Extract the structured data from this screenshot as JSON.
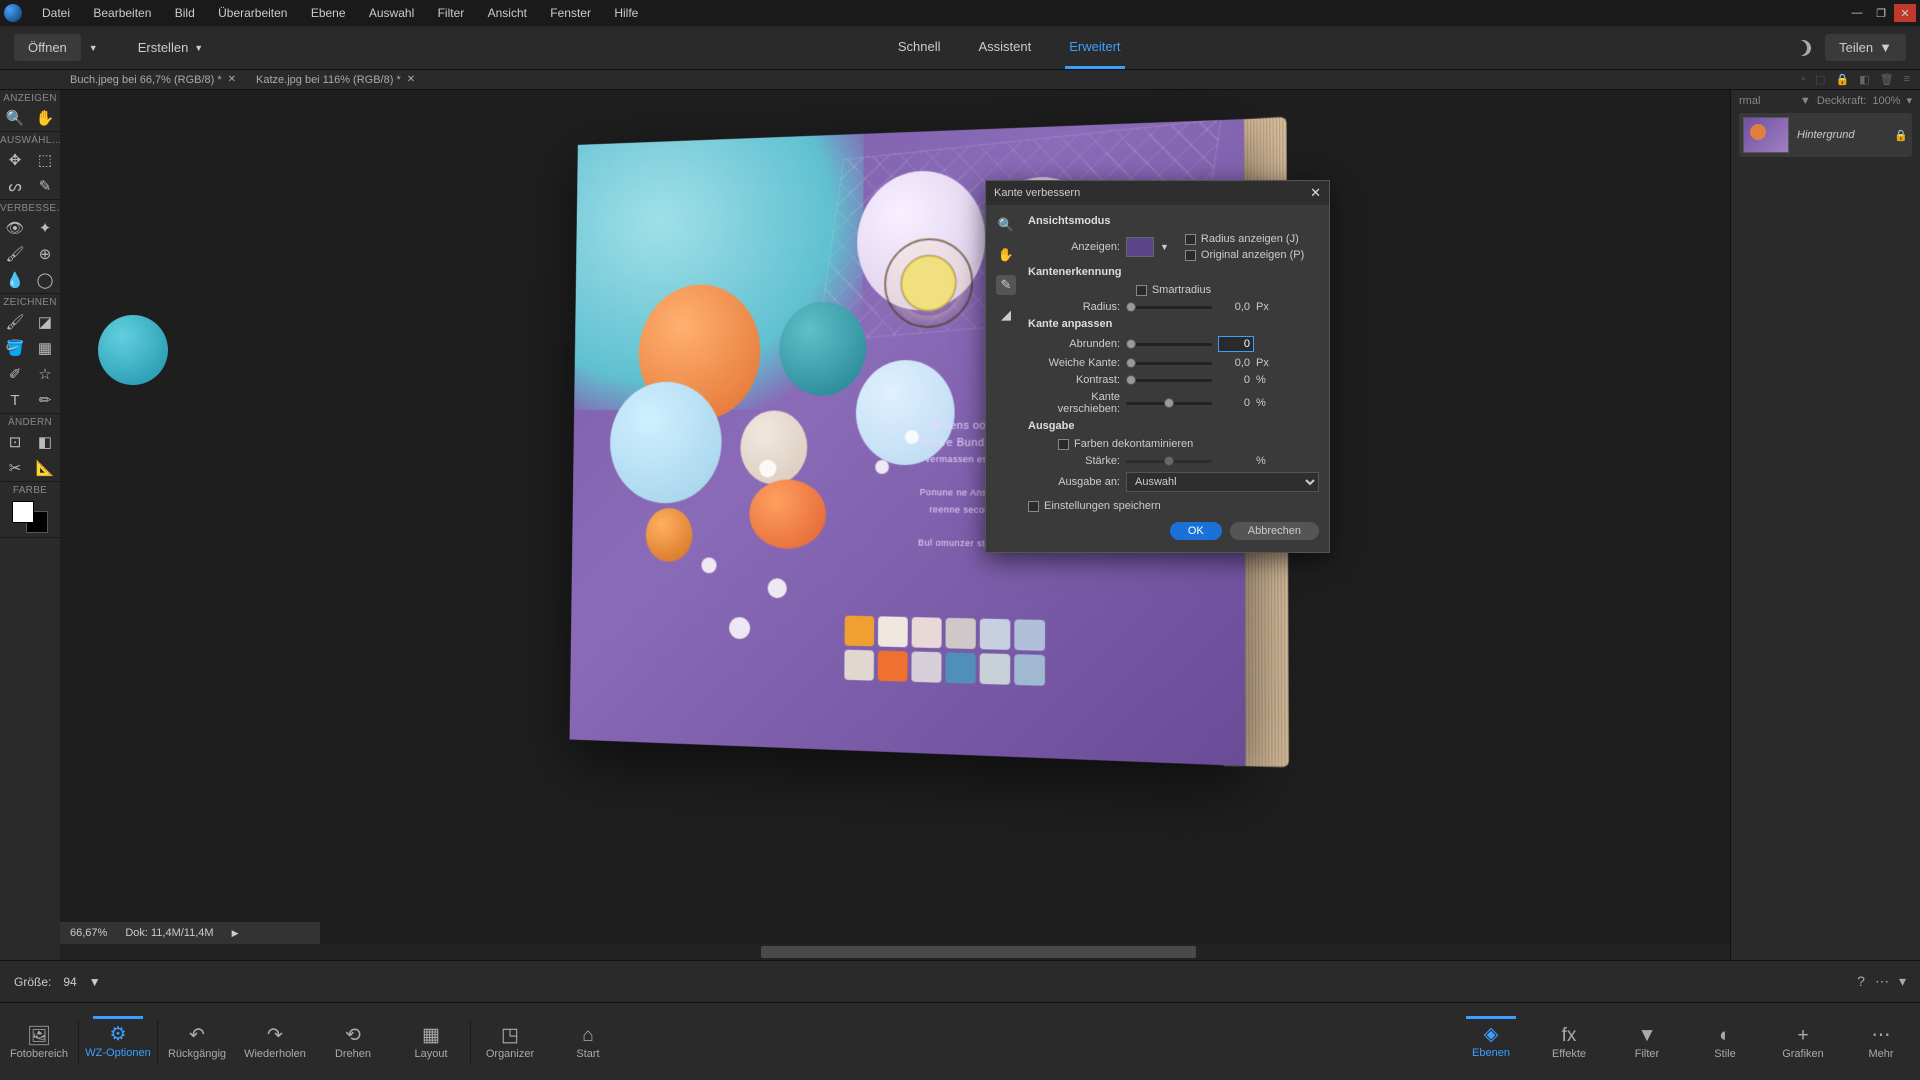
{
  "menu": [
    "Datei",
    "Bearbeiten",
    "Bild",
    "Überarbeiten",
    "Ebene",
    "Auswahl",
    "Filter",
    "Ansicht",
    "Fenster",
    "Hilfe"
  ],
  "subbar": {
    "open": "Öffnen",
    "create": "Erstellen",
    "tabs": [
      "Schnell",
      "Assistent",
      "Erweitert"
    ],
    "share": "Teilen"
  },
  "doctabs": [
    "Buch.jpeg bei 66,7% (RGB/8) *",
    "Katze.jpg bei 116% (RGB/8) *"
  ],
  "layertop": {
    "mode": "rmal",
    "opacitylabel": "Deckkraft:",
    "opacity": "100%"
  },
  "layer": {
    "name": "Hintergrund"
  },
  "tool_groups": {
    "view": "ANZEIGEN",
    "select": "AUSWÄHL…",
    "enhance": "VERBESSE…",
    "draw": "ZEICHNEN",
    "modify": "ÄNDERN",
    "color": "FARBE"
  },
  "dialog": {
    "title": "Kante verbessern",
    "sec1": "Ansichtsmodus",
    "show": "Anzeigen:",
    "radiuscb": "Radius anzeigen (J)",
    "origcb": "Original anzeigen (P)",
    "sec2": "Kantenerkennung",
    "smart": "Smartradius",
    "radius": "Radius:",
    "radiusval": "0,0",
    "px": "Px",
    "sec3": "Kante anpassen",
    "smooth": "Abrunden:",
    "smoothval": "0",
    "feather": "Weiche Kante:",
    "featherval": "0,0",
    "contrast": "Kontrast:",
    "contrastval": "0",
    "pct": "%",
    "shift": "Kante verschieben:",
    "shiftval": "0",
    "sec4": "Ausgabe",
    "decon": "Farben dekontaminieren",
    "amount": "Stärke:",
    "outputto": "Ausgabe an:",
    "outputsel": "Auswahl",
    "remember": "Einstellungen speichern",
    "ok": "OK",
    "cancel": "Abbrechen"
  },
  "status": {
    "zoom": "66,67%",
    "doc": "Dok: 11,4M/11,4M"
  },
  "optbar": {
    "size": "Größe:",
    "sizeval": "94"
  },
  "taskbar_left": [
    "Fotobereich",
    "WZ-Optionen",
    "Rückgängig",
    "Wiederholen",
    "Drehen",
    "Layout",
    "Organizer",
    "Start"
  ],
  "taskbar_right": [
    "Ebenen",
    "Effekte",
    "Filter",
    "Stile",
    "Grafiken",
    "Mehr"
  ]
}
